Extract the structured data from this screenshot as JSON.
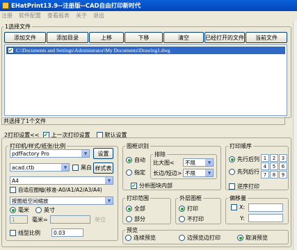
{
  "window": {
    "title": "EHatPrint13.9--注册版--CAD自由打印新时代"
  },
  "menu": [
    "注册",
    "软件配置",
    "查看报表",
    "关于",
    "退出"
  ],
  "section1": {
    "legend": "1选择文件",
    "buttons": [
      "添加文件",
      "添加目录",
      "上移",
      "下移",
      "清空",
      "已经打开的文件",
      "当前文件"
    ],
    "file_path": "C:\\Documents and Settings\\Administrator\\My Documents\\Drawing1.dwg",
    "status": "共选择了1个文件"
  },
  "section2": {
    "heading": "2打印设置<<",
    "last_settings_label": "上一次打印设置",
    "default_settings_label": "默认设置",
    "printer_group": {
      "legend": "打印机/样式/纸张/比例",
      "printer": "pdfFactory Pro",
      "settings_button": "设置",
      "style": "acad.ctb",
      "black_label": "黑白",
      "style_table_button": "样式表",
      "paper": "A4",
      "auto_paper_label": "自适应图幅(移准-A0/A1/A2/A3/A4)",
      "scale_mode": "按图纸空间缩放",
      "unit_mm": "毫米",
      "unit_inch": "英寸",
      "scale_left": "1",
      "scale_mm_label": "毫米=",
      "scale_unit_label": "单位",
      "linewidth_label": "线型比例",
      "linewidth_value": "0.03"
    },
    "recognition": {
      "legend": "图框识别",
      "auto": "自动",
      "specify": "指定",
      "exclude_label": "排除",
      "ratio_label": "比大图<",
      "ratio_value": "不限",
      "long_short_label": "长边/短边>",
      "long_short_value": "不限",
      "analyze_inner_label": "分析图块内部"
    },
    "print_order": {
      "legend": "打印顺序",
      "row_first": "先行后列",
      "col_first": "先列后行",
      "reverse": "逆序打印",
      "grid": [
        "1",
        "2",
        "3",
        "4",
        "5",
        "6",
        "7",
        "8",
        "9"
      ]
    },
    "print_range": {
      "legend": "打印范围",
      "all": "全部",
      "partial": "部分"
    },
    "outer_frame": {
      "legend": "外层图框",
      "print": "打印",
      "no_print": "不打印"
    },
    "offset": {
      "legend": "偏移量",
      "x": "X:",
      "y": "Y:"
    },
    "preview": {
      "legend": "预览",
      "continuous": "连续预览",
      "print_while_preview": "边预览边打印",
      "cancel": "取消预览"
    }
  }
}
